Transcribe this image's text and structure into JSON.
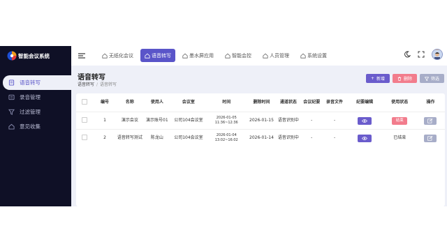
{
  "app": {
    "title": "智能会议系统"
  },
  "sidebar": {
    "items": [
      {
        "label": "语音转写",
        "icon": "document-icon",
        "active": true
      },
      {
        "label": "录音管理",
        "icon": "recording-icon",
        "active": false
      },
      {
        "label": "过滤管理",
        "icon": "filter-icon",
        "active": false
      },
      {
        "label": "意见收集",
        "icon": "home-icon",
        "active": false
      }
    ]
  },
  "tabs": [
    {
      "label": "无纸化会议",
      "active": false
    },
    {
      "label": "语音转写",
      "active": true
    },
    {
      "label": "墨水屏应用",
      "active": false
    },
    {
      "label": "智能会控",
      "active": false
    },
    {
      "label": "人员管理",
      "active": false
    },
    {
      "label": "系统设置",
      "active": false
    }
  ],
  "page": {
    "title": "语音转写",
    "breadcrumb": [
      "语音转写",
      "语音转写"
    ]
  },
  "actions": {
    "add": "新增",
    "delete": "删除",
    "filter": "筛选"
  },
  "table": {
    "headers": [
      "编号",
      "名称",
      "使用人",
      "会议室",
      "时间",
      "删除时间",
      "通道状态",
      "会议纪要",
      "录音文件",
      "纪要编辑",
      "使用状态",
      "操作"
    ],
    "rows": [
      {
        "id": "1",
        "name": "演示会议",
        "user": "演示账号01",
        "room": "公司104会议室",
        "time": "2026-01-05 11:36~12:36",
        "deleted": "2026-01-15",
        "channel": "语音识别中",
        "minutes": "-",
        "audio": "-",
        "status": "结束",
        "status_type": "button"
      },
      {
        "id": "2",
        "name": "语音转写测试",
        "user": "陈龙山",
        "room": "公司104会议室",
        "time": "2026-01-04 13:02~16:02",
        "deleted": "2026-01-14",
        "channel": "语音识别中",
        "minutes": "-",
        "audio": "-",
        "status": "已结束",
        "status_type": "text"
      }
    ]
  },
  "colors": {
    "accent": "#5a55c9",
    "sidebar": "#0f1026",
    "danger": "#f27c8c",
    "muted": "#a7adc8"
  }
}
